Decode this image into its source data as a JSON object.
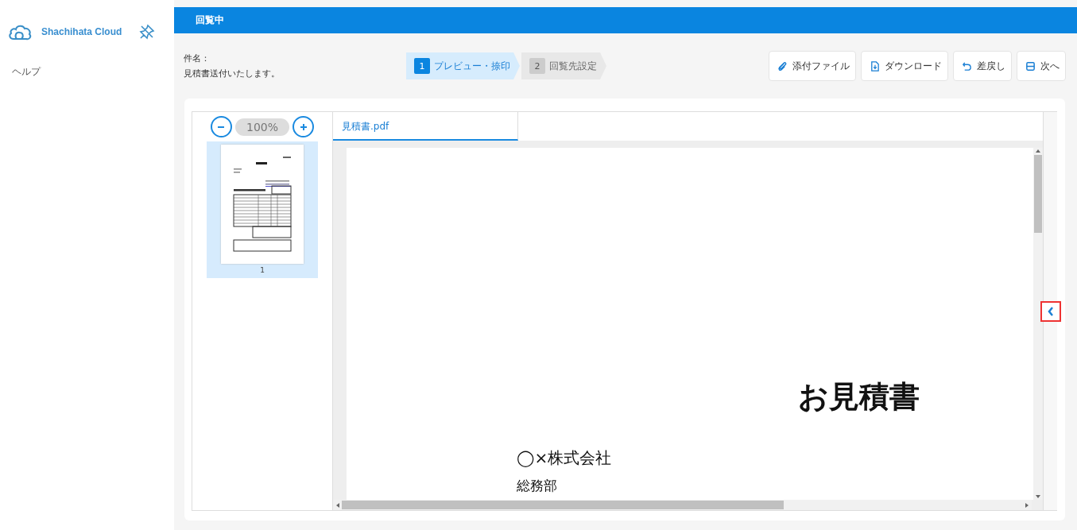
{
  "sidebar": {
    "brand": "Shachihata Cloud",
    "items": [
      {
        "label": "ヘルプ"
      }
    ]
  },
  "header": {
    "title": "回覧中"
  },
  "subject": {
    "label": "件名：",
    "value": "見積書送付いたします。"
  },
  "steps": [
    {
      "number": "1",
      "label": "プレビュー・捺印",
      "selected": true
    },
    {
      "number": "2",
      "label": "回覧先設定",
      "selected": false
    }
  ],
  "actions": [
    {
      "kind": "attach",
      "label": "添付ファイル"
    },
    {
      "kind": "download",
      "label": "ダウンロード"
    },
    {
      "kind": "return",
      "label": "差戻し"
    },
    {
      "kind": "next",
      "label": "次へ"
    }
  ],
  "zoom": {
    "value": "100%"
  },
  "pages": [
    {
      "number": "1",
      "selected": true
    }
  ],
  "tabs": [
    {
      "label": "見積書.pdf",
      "selected": true
    }
  ],
  "document": {
    "title": "お見積書",
    "recipient": "◯×株式会社",
    "department": "総務部"
  }
}
